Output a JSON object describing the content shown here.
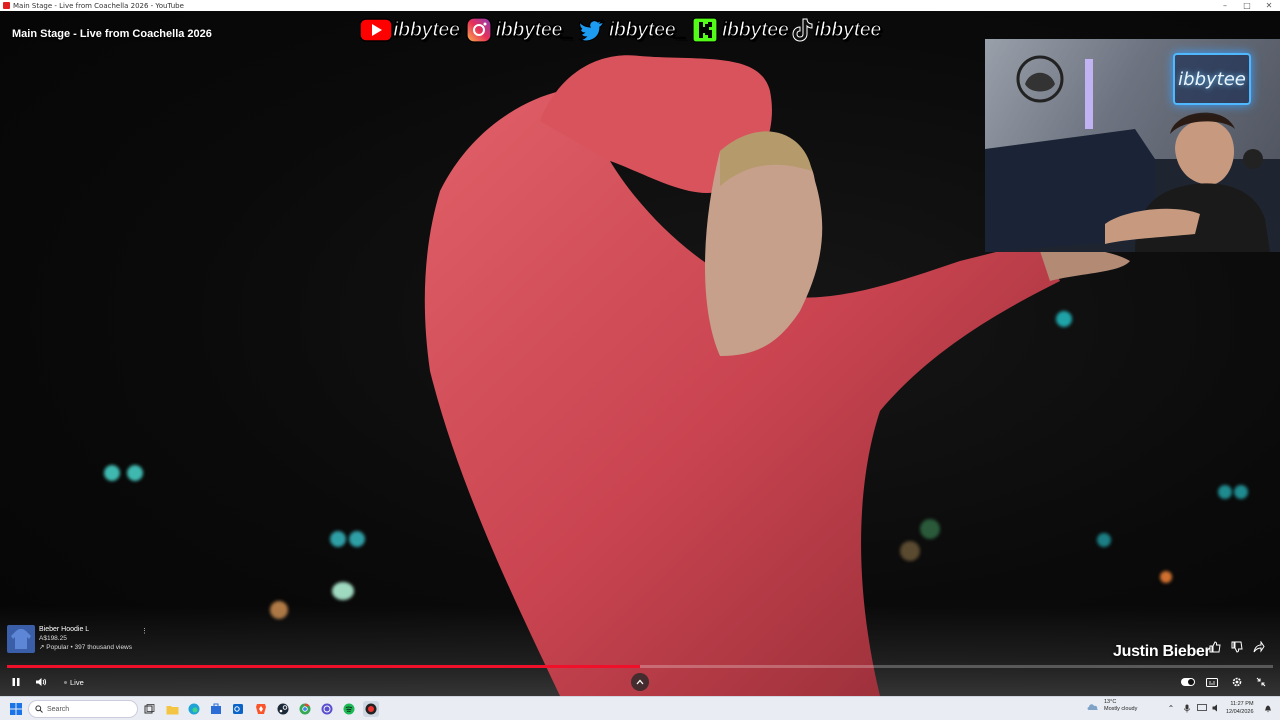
{
  "window": {
    "title": "Main Stage - Live from Coachella 2026 - YouTube",
    "controls": [
      "–",
      "□",
      "✕"
    ]
  },
  "video": {
    "title": "Main Stage - Live from Coachella 2026",
    "artist_label": "Justin Bieber"
  },
  "socials": [
    {
      "icon": "youtube-icon",
      "handle": "ibbytee"
    },
    {
      "icon": "instagram-icon",
      "handle": "ibbytee_"
    },
    {
      "icon": "twitter-icon",
      "handle": "ibbytee_"
    },
    {
      "icon": "kick-icon",
      "handle": "ibbytee"
    },
    {
      "icon": "tiktok-icon",
      "handle": "ibbytee"
    }
  ],
  "webcam": {
    "sign_text": "ibbytee"
  },
  "product": {
    "name": "Bieber Hoodie L",
    "price": "A$198.25",
    "meta": "↗ Popular • 397 thousand views"
  },
  "player": {
    "live_label": "Live",
    "progress_fraction": 0.5
  },
  "taskbar": {
    "search_placeholder": "Search",
    "weather_temp": "13°C",
    "weather_desc": "Mostly cloudy",
    "time": "11:27 PM",
    "date": "12/04/2026"
  },
  "colors": {
    "youtube_red": "#f0102a",
    "kick_green": "#53fc18",
    "twitter_blue": "#1d9bf0",
    "hoodie_red": "#d5454f"
  }
}
